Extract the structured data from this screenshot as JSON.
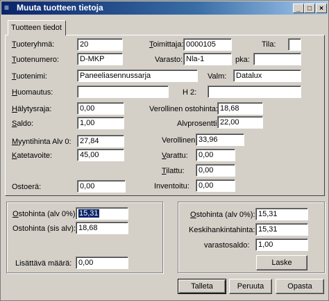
{
  "window": {
    "title": "Muuta tuotteen tietoja"
  },
  "tab": {
    "label": "Tuotteen tiedot"
  },
  "fields": {
    "tuoteryhma": {
      "label": "Tuoteryhmä:",
      "value": "20"
    },
    "toimittaja": {
      "label": "Toimittaja:",
      "value": "0000105"
    },
    "tila": {
      "label": "Tila:",
      "value": ""
    },
    "tuotenumero": {
      "label": "Tuotenumero:",
      "value": "D-MKP"
    },
    "varasto": {
      "label": "Varasto:",
      "value": "Nla-1"
    },
    "pka": {
      "label": "pka:",
      "value": ""
    },
    "tuotenimi": {
      "label": "Tuotenimi:",
      "value": "Paneeliasennussarja"
    },
    "valm": {
      "label": "Valm:",
      "value": "Datalux"
    },
    "huomautus": {
      "label": "Huomautus:",
      "value": ""
    },
    "h2": {
      "label": "H 2:",
      "value": ""
    },
    "halytysraja": {
      "label": "Hälytysraja:",
      "value": "0,00"
    },
    "verollinen_ostohinta": {
      "label": "Verollinen ostohinta:",
      "value": "18,68"
    },
    "saldo": {
      "label": "Saldo:",
      "value": "1,00"
    },
    "alvprosentti": {
      "label": "Alvprosentti:",
      "value": "22,00"
    },
    "myyntihinta": {
      "label": "Myyntihinta Alv 0:",
      "value": "27,84"
    },
    "verollinen": {
      "label": "Verollinen:",
      "value": "33,96"
    },
    "katetavoite": {
      "label": "Katetavoite:",
      "value": "45,00"
    },
    "varattu": {
      "label": "Varattu:",
      "value": "0,00"
    },
    "tilattu": {
      "label": "Tilattu:",
      "value": "0,00"
    },
    "ostoera": {
      "label": "Ostoerä:",
      "value": "0,00"
    },
    "inventoitu": {
      "label": "Inventoitu:",
      "value": "0,00"
    }
  },
  "left_group": {
    "ostohinta_alv0": {
      "label": "Ostohinta (alv 0%):",
      "value": "15,31"
    },
    "ostohinta_sis": {
      "label": "Ostohinta (sis alv):",
      "value": "18,68"
    },
    "lisattava": {
      "label": "Lisättävä määrä:",
      "value": "0,00"
    }
  },
  "right_group": {
    "ostohinta_alv0": {
      "label": "Ostohinta (alv 0%):",
      "value": "15,31"
    },
    "keskihankinta": {
      "label": "Keskihankintahinta:",
      "value": "15,31"
    },
    "varastosaldo": {
      "label": "varastosaldo:",
      "value": "1,00"
    },
    "laske": "Laske"
  },
  "buttons": {
    "talleta": "Talleta",
    "peruuta": "Peruuta",
    "opasta": "Opasta"
  },
  "icons": {
    "app": "app-icon",
    "minimize": "minimize-icon",
    "maximize": "maximize-icon",
    "close": "close-icon"
  }
}
